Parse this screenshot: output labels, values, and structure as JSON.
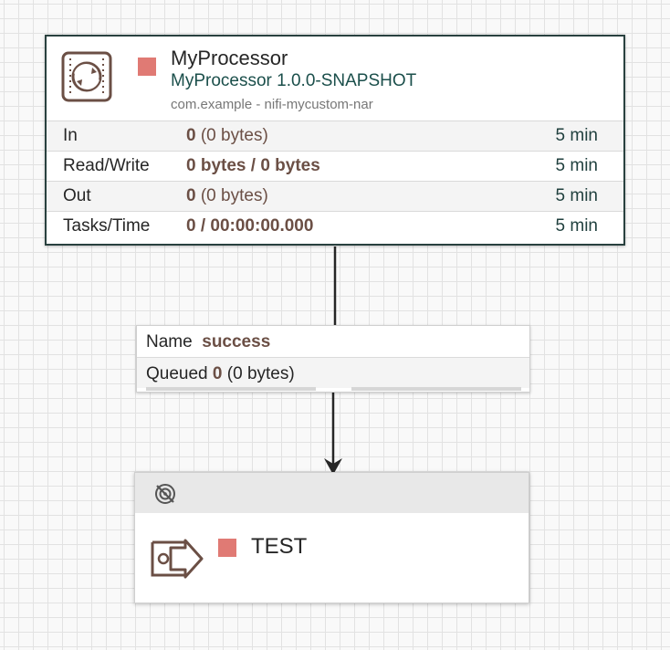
{
  "processor": {
    "name": "MyProcessor",
    "type": "MyProcessor 1.0.0-SNAPSHOT",
    "bundle": "com.example - nifi-mycustom-nar",
    "icon": "processor-icon",
    "status_color": "#e07a74",
    "stats": [
      {
        "label": "In",
        "value": "0",
        "detail": "(0 bytes)",
        "window": "5 min"
      },
      {
        "label": "Read/Write",
        "value": "0 bytes / 0 bytes",
        "detail": "",
        "window": "5 min"
      },
      {
        "label": "Out",
        "value": "0",
        "detail": "(0 bytes)",
        "window": "5 min"
      },
      {
        "label": "Tasks/Time",
        "value": "0 / 00:00:00.000",
        "detail": "",
        "window": "5 min"
      }
    ]
  },
  "connection": {
    "name_label": "Name",
    "name_value": "success",
    "queued_label": "Queued",
    "queued_value": "0",
    "queued_detail": "(0 bytes)"
  },
  "output_port": {
    "name": "TEST",
    "header_icon": "transmission-disabled-icon",
    "icon": "output-port-icon",
    "status_color": "#e07a74"
  },
  "colors": {
    "accent": "#29413f",
    "value_brown": "#6b4f45",
    "stopped_red": "#e07a74"
  }
}
